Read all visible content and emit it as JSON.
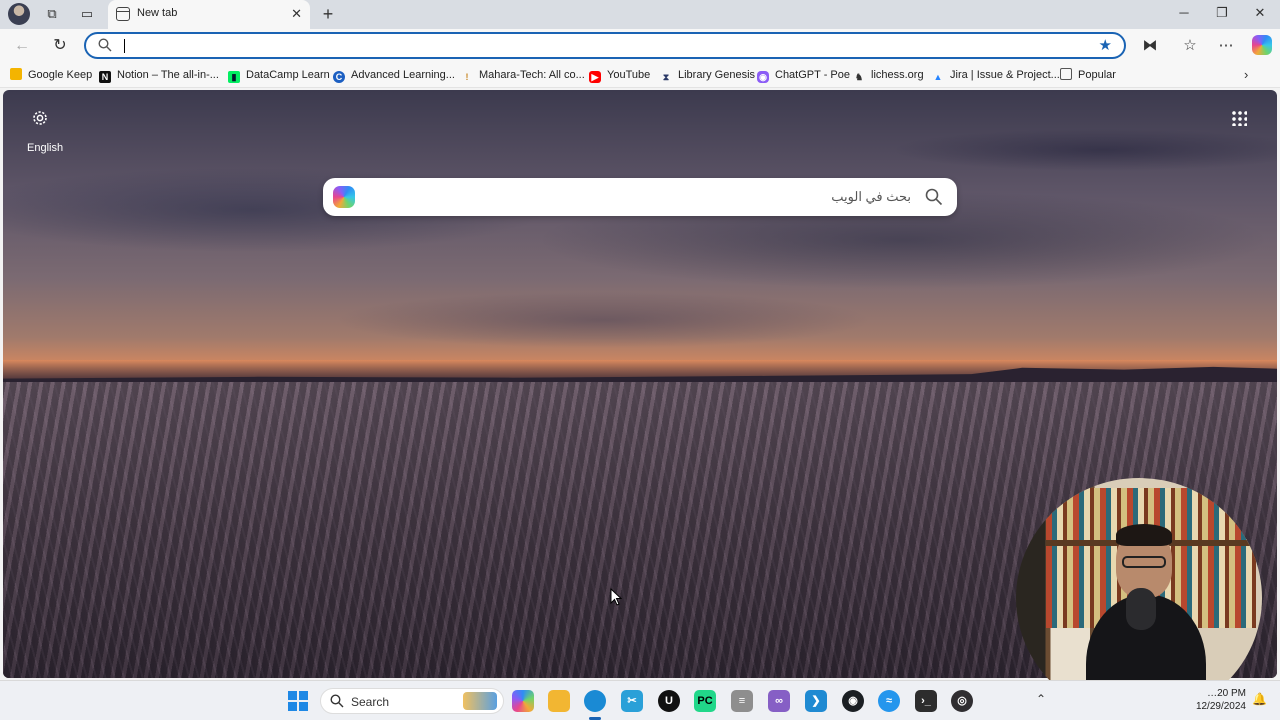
{
  "browser": {
    "tab": {
      "title": "New tab"
    },
    "window_controls": {
      "minimize": "─",
      "maximize": "❐",
      "close": "✕"
    },
    "new_tab_glyph": "+",
    "address_bar": {
      "value": "",
      "placeholder": ""
    }
  },
  "bookmarks": [
    {
      "label": "Google Keep",
      "icon": "google-keep-icon",
      "color": "#f4b400"
    },
    {
      "label": "Notion – The all-in-...",
      "icon": "notion-icon",
      "color": "#111111"
    },
    {
      "label": "DataCamp Learn",
      "icon": "datacamp-icon",
      "color": "#03ef62"
    },
    {
      "label": "Advanced Learning...",
      "icon": "coursera-icon",
      "color": "#1c5fc2"
    },
    {
      "label": "Mahara-Tech: All co...",
      "icon": "mahara-tech-icon",
      "color": "#c98a2a"
    },
    {
      "label": "YouTube",
      "icon": "youtube-icon",
      "color": "#ff0000"
    },
    {
      "label": "Library Genesis",
      "icon": "libgen-icon",
      "color": "#2b3a67"
    },
    {
      "label": "ChatGPT - Poe",
      "icon": "poe-icon",
      "color": "#8b5cf6"
    },
    {
      "label": "lichess.org",
      "icon": "lichess-icon",
      "color": "#333333"
    },
    {
      "label": "Jira | Issue & Project...",
      "icon": "jira-icon",
      "color": "#2684ff"
    },
    {
      "label": "Popular",
      "icon": "folder-icon",
      "color": "#555555"
    }
  ],
  "newtab": {
    "language": "English",
    "search_placeholder": "بحث في الويب"
  },
  "taskbar": {
    "search_label": "Search",
    "clock_time": "…20 PM",
    "clock_date": "12/29/2024",
    "apps": [
      {
        "name": "copilot-app",
        "color": "#8b5cf6"
      },
      {
        "name": "file-explorer",
        "color": "#f2b632"
      },
      {
        "name": "edge-browser",
        "color": "#1a8ad4"
      },
      {
        "name": "snipping-tool",
        "color": "#2aa0d8"
      },
      {
        "name": "unreal-engine",
        "color": "#111111"
      },
      {
        "name": "pycharm",
        "color": "#21d789"
      },
      {
        "name": "database-app",
        "color": "#8e8e8e"
      },
      {
        "name": "visual-studio",
        "color": "#865fc5"
      },
      {
        "name": "vscode",
        "color": "#1f8ad2"
      },
      {
        "name": "github-desktop",
        "color": "#1b1f23"
      },
      {
        "name": "docker",
        "color": "#2496ed"
      },
      {
        "name": "terminal",
        "color": "#2d2d2d"
      },
      {
        "name": "obs-studio",
        "color": "#302e31"
      }
    ]
  }
}
